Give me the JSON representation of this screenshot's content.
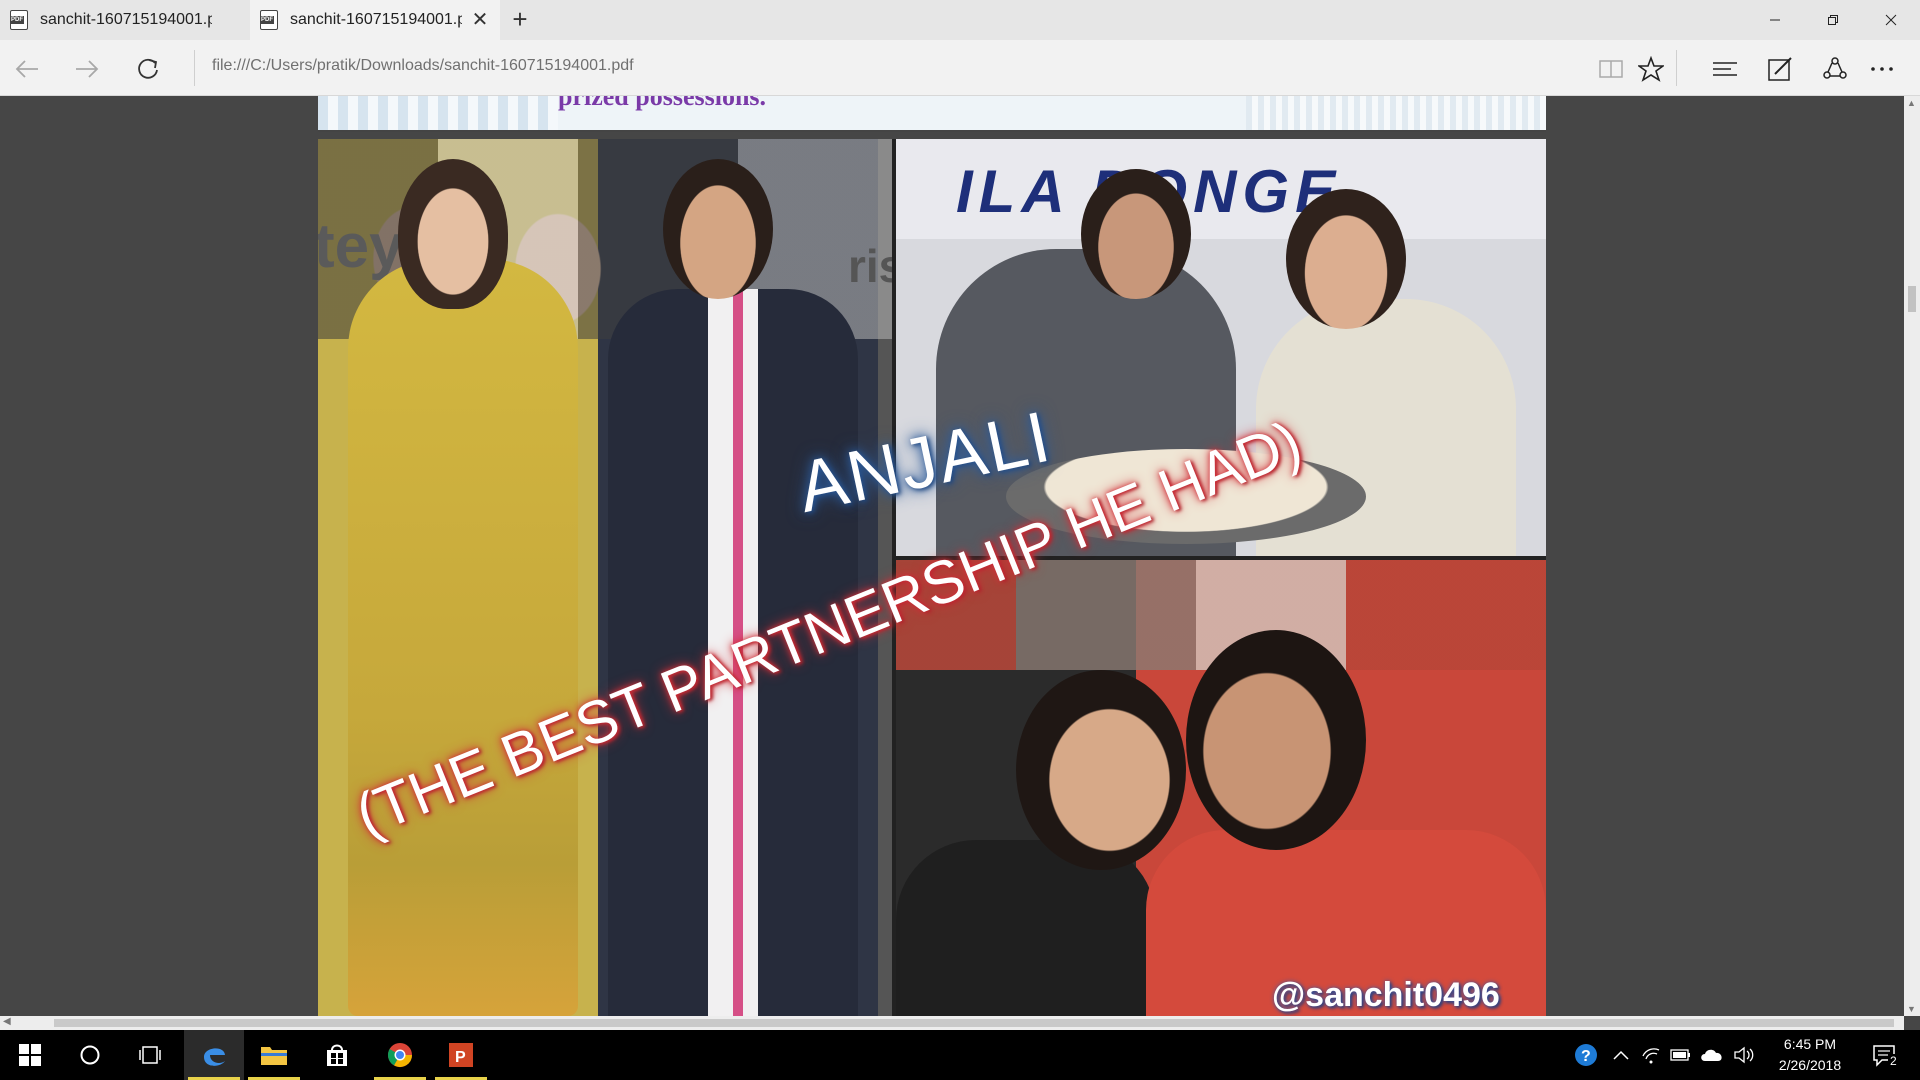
{
  "browser": {
    "tabs": [
      {
        "label": "sanchit-160715194001.pdf",
        "active": false
      },
      {
        "label": "sanchit-160715194001.pdf",
        "active": true
      }
    ],
    "address": "file:///C:/Users/pratik/Downloads/sanchit-160715194001.pdf"
  },
  "document": {
    "cut_off_text": "prized possessions.",
    "photo_texts": {
      "banner": "ILA DONGE",
      "logo_left": "tey",
      "logo_right": "ris"
    },
    "overlay_title": "ANJALI",
    "overlay_subtitle": "(THE BEST PARTNERSHIP HE HAD)",
    "handle": "@sanchit0496"
  },
  "taskbar": {
    "apps": [
      "start",
      "cortana",
      "task-view",
      "edge",
      "file-explorer",
      "store",
      "chrome",
      "powerpoint"
    ],
    "time": "6:45 PM",
    "date": "2/26/2018",
    "notification_count": "2"
  },
  "colors": {
    "accent_running": "#e8d24a",
    "overlay_red": "#d2303a",
    "overlay_blue": "#2e5d9c"
  }
}
